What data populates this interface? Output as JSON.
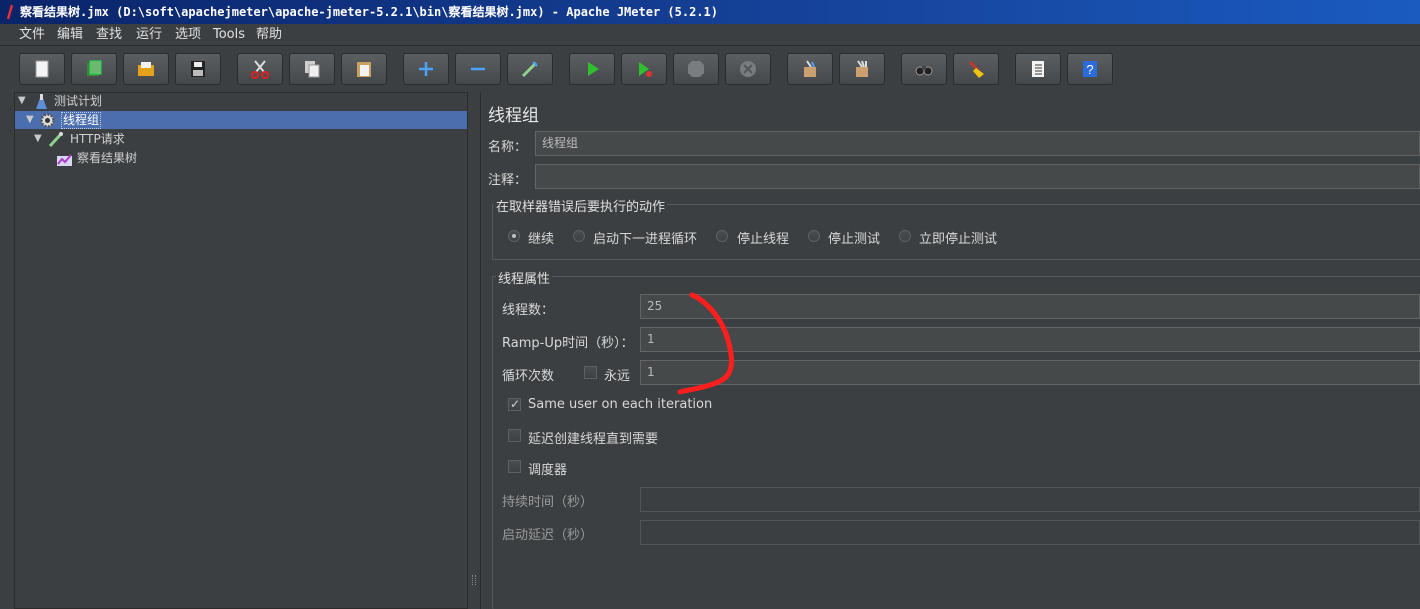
{
  "window": {
    "title": "察看结果树.jmx (D:\\soft\\apachejmeter\\apache-jmeter-5.2.1\\bin\\察看结果树.jmx) - Apache JMeter (5.2.1)"
  },
  "menu": [
    "文件",
    "编辑",
    "查找",
    "运行",
    "选项",
    "Tools",
    "帮助"
  ],
  "toolbar": {
    "buttons": [
      {
        "name": "new-icon"
      },
      {
        "name": "templates-icon"
      },
      {
        "name": "open-icon"
      },
      {
        "name": "save-icon"
      },
      {
        "name": "cut-icon"
      },
      {
        "name": "copy-icon"
      },
      {
        "name": "paste-icon"
      },
      {
        "name": "expand-icon"
      },
      {
        "name": "collapse-icon"
      },
      {
        "name": "toggle-icon"
      },
      {
        "name": "start-icon"
      },
      {
        "name": "start-no-pause-icon"
      },
      {
        "name": "stop-icon"
      },
      {
        "name": "shutdown-icon"
      },
      {
        "name": "clear-icon"
      },
      {
        "name": "clear-all-icon"
      },
      {
        "name": "search-icon"
      },
      {
        "name": "reset-search-icon"
      },
      {
        "name": "function-helper-icon"
      },
      {
        "name": "help-icon"
      }
    ]
  },
  "tree": {
    "test_plan": "测试计划",
    "thread_group": "线程组",
    "http_request": "HTTP请求",
    "view_results": "察看结果树"
  },
  "panel": {
    "title": "线程组",
    "name_label": "名称：",
    "name_value": "线程组",
    "comment_label": "注释：",
    "comment_value": "",
    "error_action": {
      "title": "在取样器错误后要执行的动作",
      "options": [
        "继续",
        "启动下一进程循环",
        "停止线程",
        "停止测试",
        "立即停止测试"
      ],
      "selected": "继续"
    },
    "thread_props": {
      "title": "线程属性",
      "threads_label": "线程数：",
      "threads_value": "25",
      "rampup_label": "Ramp-Up时间（秒）：",
      "rampup_value": "1",
      "loop_label": "循环次数",
      "forever_label": "永远",
      "forever_checked": false,
      "loop_value": "1",
      "same_user_label": "Same user on each iteration",
      "same_user_checked": true,
      "delay_label": "延迟创建线程直到需要",
      "delay_checked": false,
      "scheduler_label": "调度器",
      "scheduler_checked": false,
      "duration_label": "持续时间（秒）",
      "duration_value": "",
      "startup_delay_label": "启动延迟（秒）",
      "startup_delay_value": ""
    }
  },
  "colors": {
    "background": "#3c3f41",
    "selection": "#4b6eaf",
    "annotation": "#ff2020",
    "title_bar": "#0a246a"
  }
}
